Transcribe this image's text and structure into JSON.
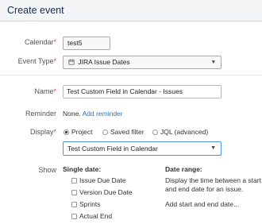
{
  "dialog": {
    "title": "Create event"
  },
  "calendar": {
    "label": "Calendar",
    "value": "test5"
  },
  "event_type": {
    "label": "Event Type",
    "value": "JIRA Issue Dates"
  },
  "name": {
    "label": "Name",
    "value": "Test Custom Field in Calendar - Issues"
  },
  "reminder": {
    "label": "Reminder",
    "value": "None.",
    "add_link": "Add reminder"
  },
  "display": {
    "label": "Display",
    "options": [
      "Project",
      "Saved filter",
      "JQL (advanced)"
    ],
    "selected": "Project",
    "project_value": "Test Custom Field in Calendar"
  },
  "show": {
    "label": "Show",
    "single_date": {
      "heading": "Single date:",
      "options": [
        "Issue Due Date",
        "Version Due Date",
        "Sprints",
        "Actual End"
      ]
    },
    "date_range": {
      "heading": "Date range:",
      "description": [
        "Display the time between a start",
        "and end date for an issue."
      ],
      "add_link": "Add start and end date..."
    }
  },
  "required_marker": "*",
  "colors": {
    "link": "#3572b0",
    "required": "#d04437",
    "focus": "#4a90e2"
  }
}
